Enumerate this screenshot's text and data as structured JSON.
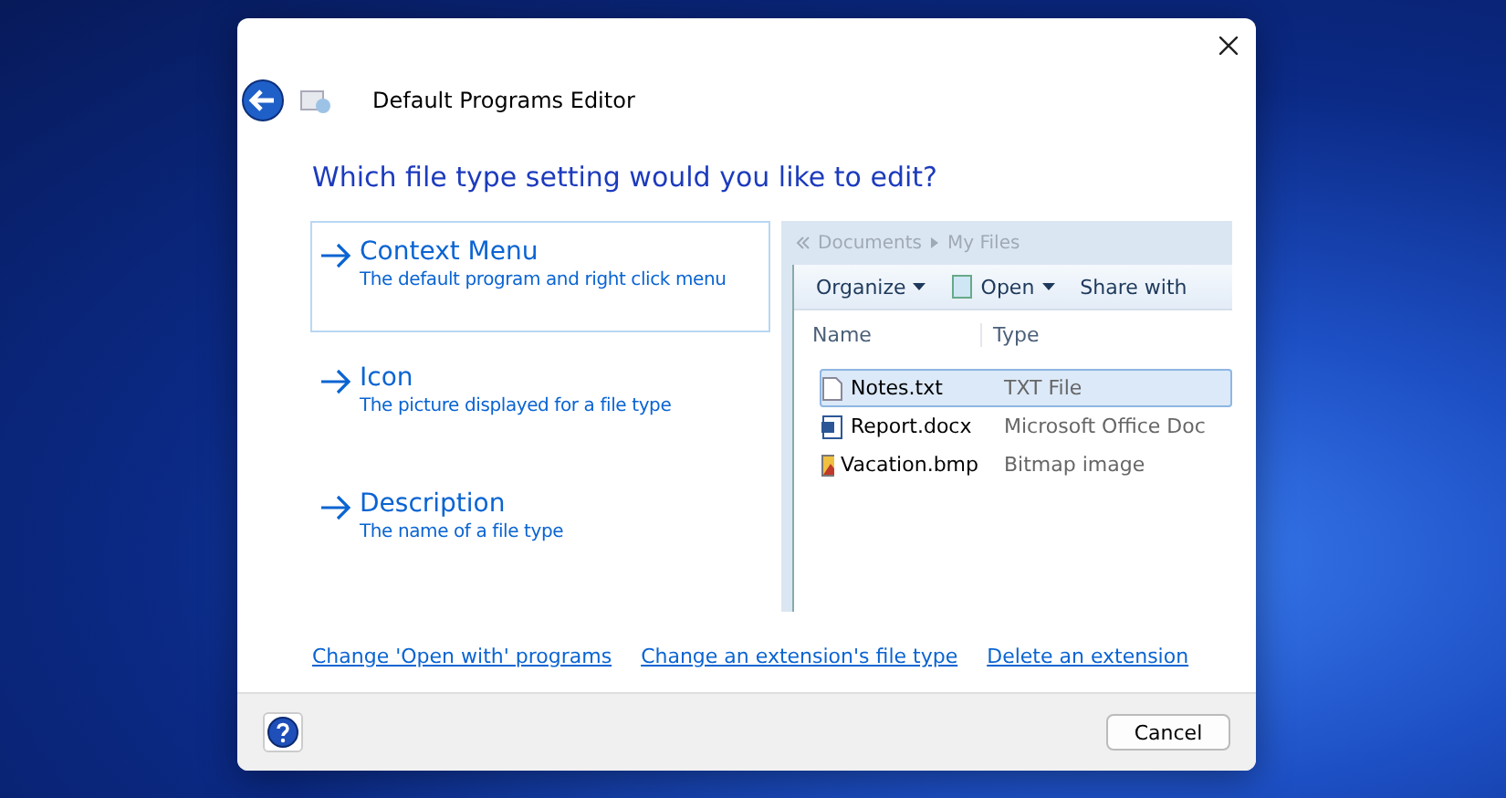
{
  "window": {
    "title": "Default Programs Editor"
  },
  "heading": "Which file type setting would you like to edit?",
  "options": [
    {
      "title": "Context Menu",
      "description": "The default program and right click menu",
      "selected": true
    },
    {
      "title": "Icon",
      "description": "The picture displayed for a file type",
      "selected": false
    },
    {
      "title": "Description",
      "description": "The name of a file type",
      "selected": false
    }
  ],
  "preview": {
    "breadcrumb": [
      "Documents",
      "My Files"
    ],
    "toolbar": [
      "Organize",
      "Open",
      "Share with"
    ],
    "columns": [
      "Name",
      "Type"
    ],
    "files": [
      {
        "kind": "text",
        "name": "Notes.txt",
        "type": "TXT File",
        "selected": true
      },
      {
        "kind": "word",
        "name": "Report.docx",
        "type": "Microsoft Office Doc",
        "selected": false
      },
      {
        "kind": "image",
        "name": "Vacation.bmp",
        "type": "Bitmap image",
        "selected": false
      }
    ]
  },
  "links": [
    "Change 'Open with' programs",
    "Change an extension's file type",
    "Delete an extension"
  ],
  "buttons": [
    "Cancel"
  ]
}
